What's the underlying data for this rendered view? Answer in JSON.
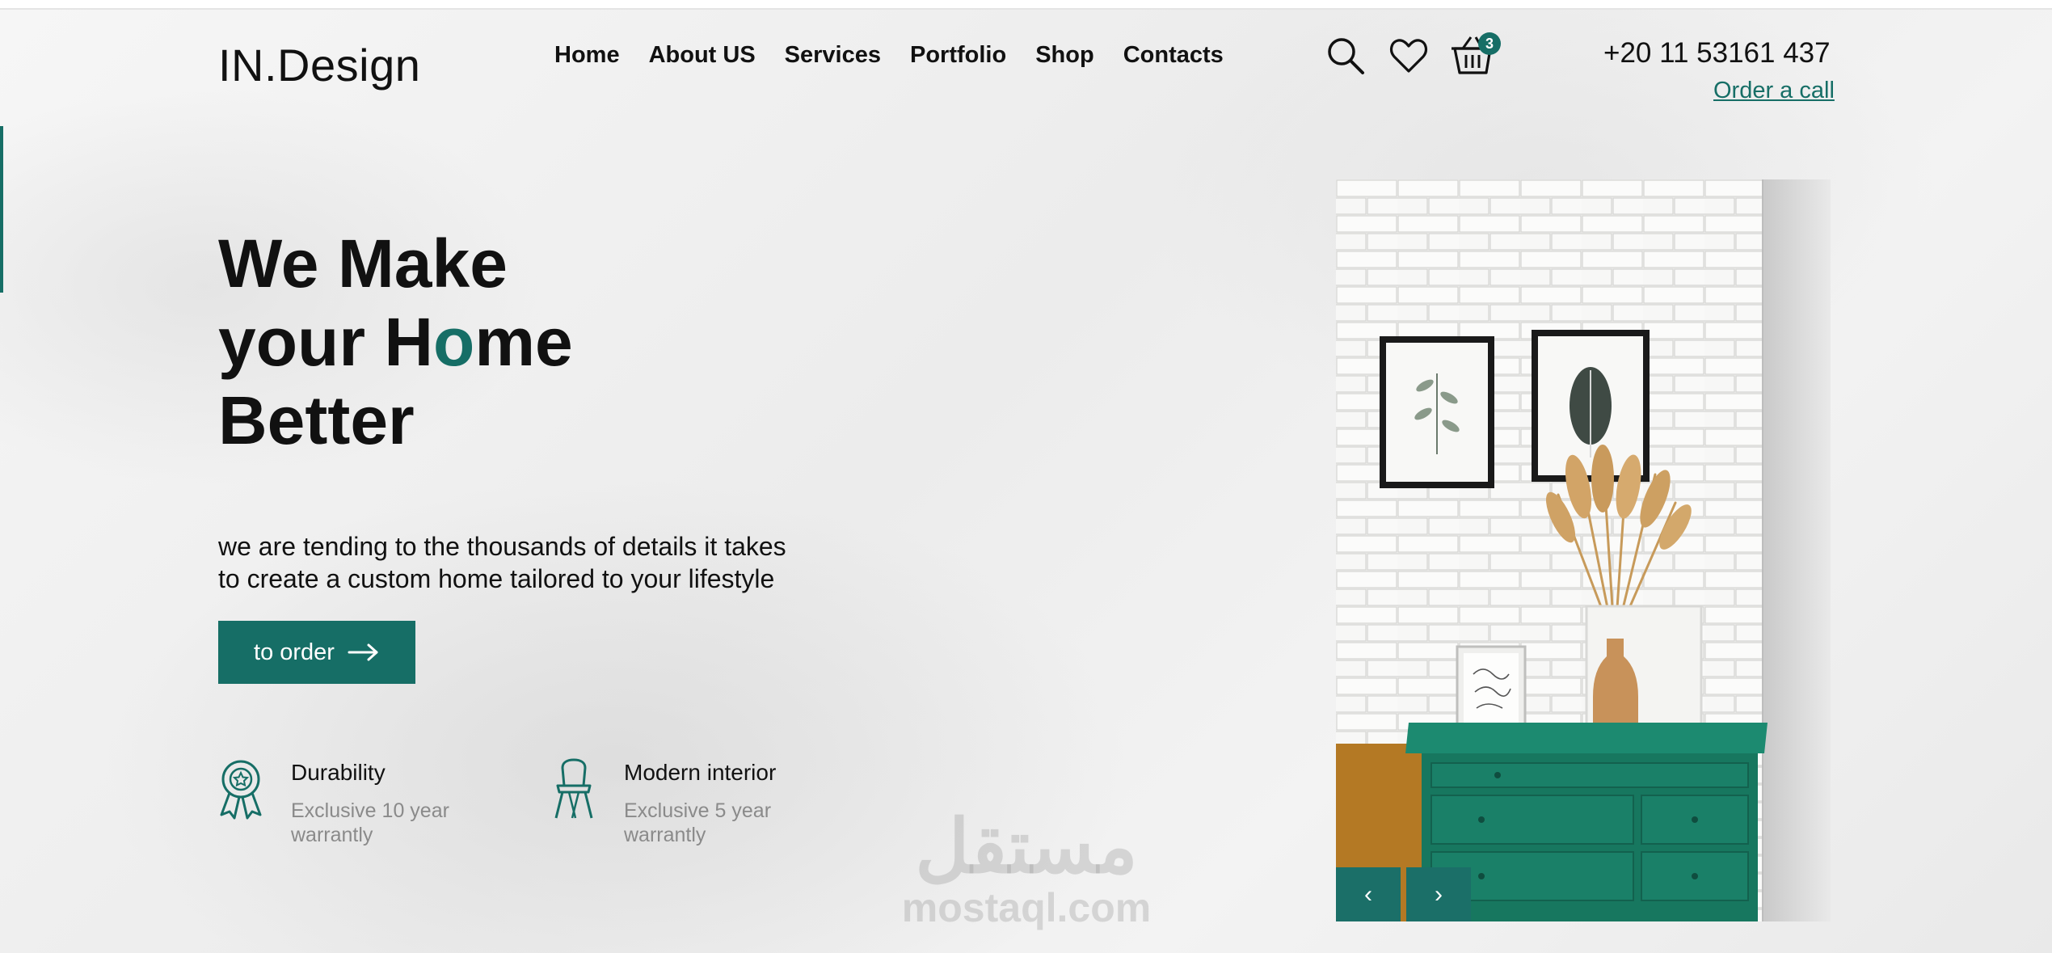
{
  "brand": {
    "logo": "IN.Design",
    "accent_color": "#166e66"
  },
  "nav": {
    "items": [
      {
        "label": "Home"
      },
      {
        "label": "About US"
      },
      {
        "label": "Services"
      },
      {
        "label": "Portfolio"
      },
      {
        "label": "Shop"
      },
      {
        "label": "Contacts"
      }
    ]
  },
  "header_icons": {
    "search": "search-icon",
    "favorites": "heart-icon",
    "cart": "basket-icon",
    "cart_count": "3"
  },
  "contact": {
    "phone": "+20 11 53161 437",
    "order_call": "Order a call"
  },
  "hero": {
    "title_line1": "We Make",
    "title_line2_before": "your H",
    "title_line2_highlight": "o",
    "title_line2_after": "me",
    "title_line3": "Better",
    "description_line1": "we are tending to the thousands of details it takes",
    "description_line2": "to create a custom home tailored to your lifestyle",
    "cta_label": "to order",
    "cta_icon": "arrow-right-icon"
  },
  "features": [
    {
      "icon": "award-ribbon-icon",
      "title": "Durability",
      "subtitle": "Exclusive 10 year warrantly"
    },
    {
      "icon": "chair-icon",
      "title": "Modern interior",
      "subtitle": "Exclusive 5 year warrantly"
    }
  ],
  "slider": {
    "prev_label": "‹",
    "next_label": "›"
  },
  "watermark": {
    "arabic": "مستقل",
    "latin": "mostaql.com"
  }
}
